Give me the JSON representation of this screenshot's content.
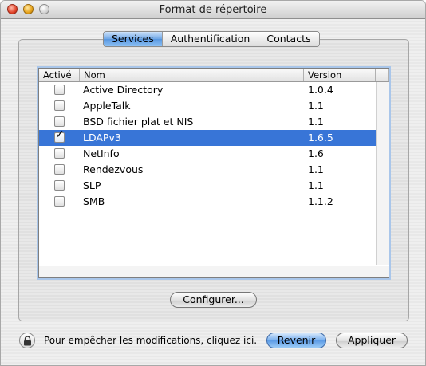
{
  "window": {
    "title": "Format de répertoire"
  },
  "tabs": [
    {
      "label": "Services",
      "active": true
    },
    {
      "label": "Authentification",
      "active": false
    },
    {
      "label": "Contacts",
      "active": false
    }
  ],
  "table": {
    "headers": {
      "active": "Activé",
      "name": "Nom",
      "version": "Version"
    },
    "rows": [
      {
        "name": "Active Directory",
        "version": "1.0.4",
        "checked": false,
        "selected": false
      },
      {
        "name": "AppleTalk",
        "version": "1.1",
        "checked": false,
        "selected": false
      },
      {
        "name": "BSD fichier plat et NIS",
        "version": "1.1",
        "checked": false,
        "selected": false
      },
      {
        "name": "LDAPv3",
        "version": "1.6.5",
        "checked": true,
        "selected": true
      },
      {
        "name": "NetInfo",
        "version": "1.6",
        "checked": false,
        "selected": false
      },
      {
        "name": "Rendezvous",
        "version": "1.1",
        "checked": false,
        "selected": false
      },
      {
        "name": "SLP",
        "version": "1.1",
        "checked": false,
        "selected": false
      },
      {
        "name": "SMB",
        "version": "1.1.2",
        "checked": false,
        "selected": false
      }
    ]
  },
  "buttons": {
    "configure": "Configurer...",
    "revert": "Revenir",
    "apply": "Appliquer"
  },
  "lock": {
    "message": "Pour empêcher les modifications, cliquez ici.",
    "icon": "lock-icon"
  },
  "colors": {
    "selection": "#3875d7",
    "default_button": "#5c9be6"
  }
}
